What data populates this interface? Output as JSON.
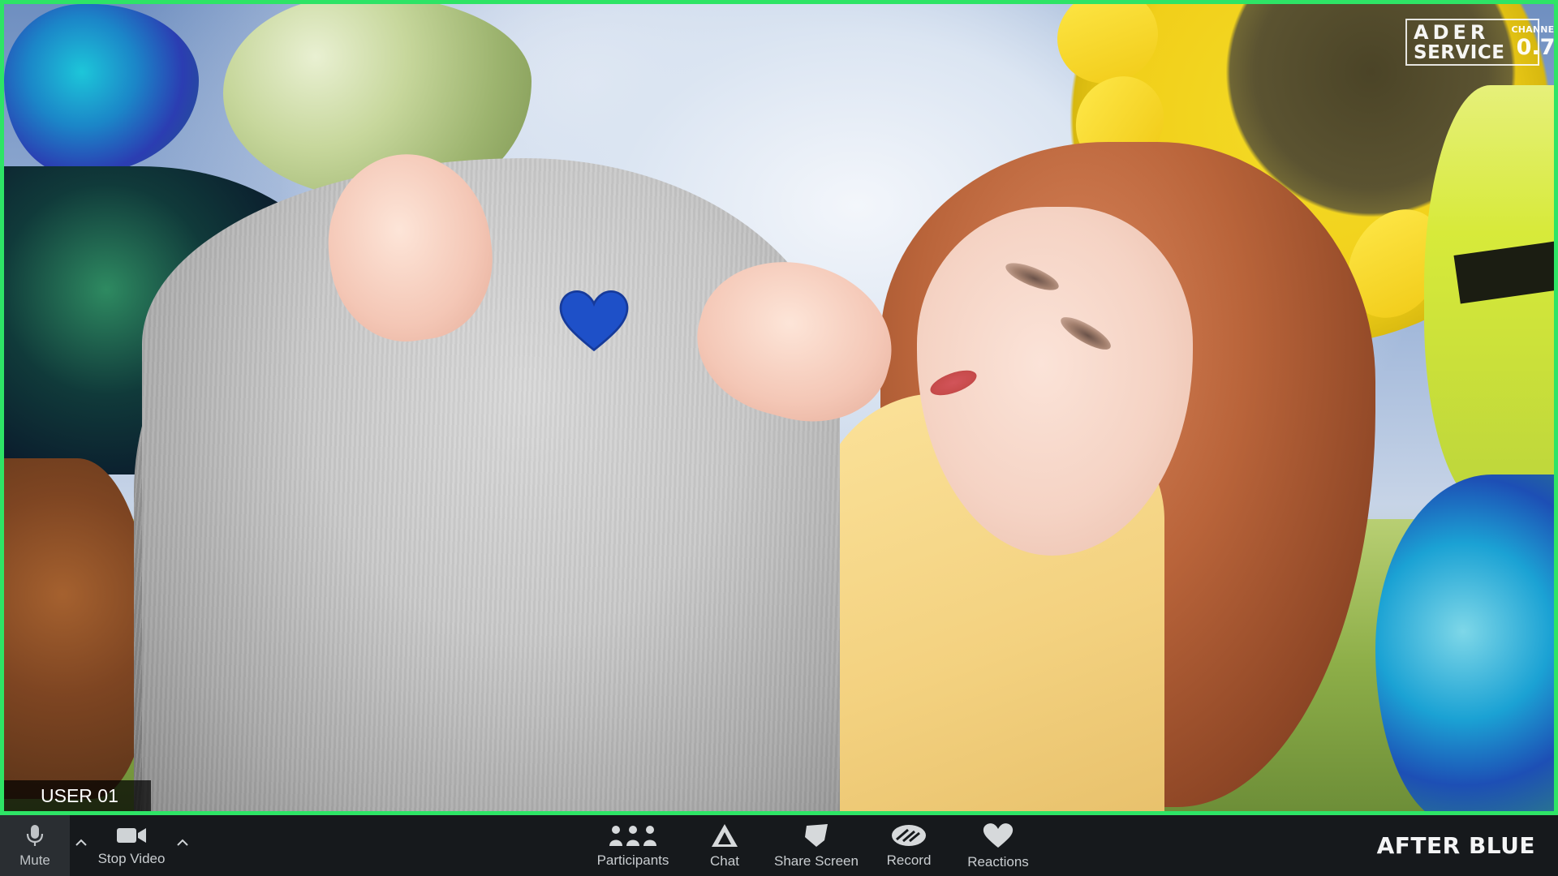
{
  "video": {
    "participant_label": "USER 01",
    "border_color": "#2ee466"
  },
  "channel_badge": {
    "line1": "ADER",
    "line2": "SERVICE",
    "channel_label": "CHANNEL",
    "channel_number": "0.7"
  },
  "toolbar": {
    "buttons": {
      "mute": {
        "label": "Mute",
        "icon": "microphone-icon"
      },
      "stop_video": {
        "label": "Stop Video",
        "icon": "video-camera-icon"
      },
      "participants": {
        "label": "Participants",
        "icon": "participants-icon"
      },
      "chat": {
        "label": "Chat",
        "icon": "chat-icon"
      },
      "share_screen": {
        "label": "Share Screen",
        "icon": "share-screen-icon"
      },
      "record": {
        "label": "Record",
        "icon": "record-icon"
      },
      "reactions": {
        "label": "Reactions",
        "icon": "heart-icon"
      }
    },
    "brand": "AFTER BLUE"
  },
  "colors": {
    "accent_green": "#2ee466",
    "toolbar_bg": "#16191c",
    "mute_bg": "#2a2e32",
    "heart_blue": "#1e50c8"
  }
}
